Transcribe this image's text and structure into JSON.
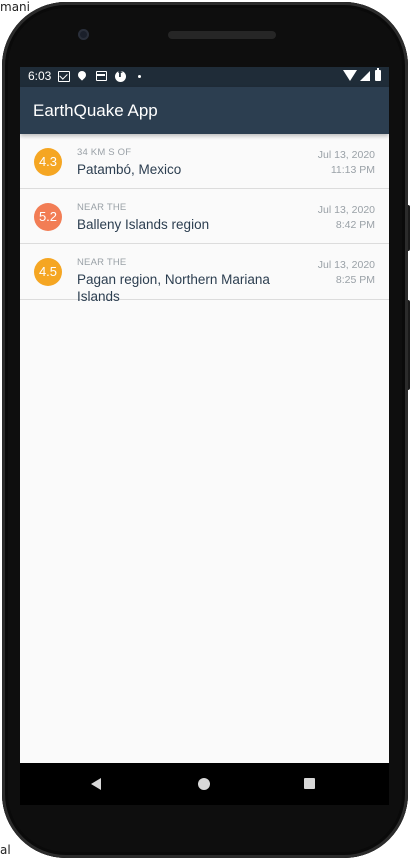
{
  "background": {
    "top_left_text": "mani",
    "left_text": "al"
  },
  "status_bar": {
    "time": "6:03",
    "icons": [
      "gmail-icon",
      "location-pin-icon",
      "card-icon",
      "facebook-icon",
      "notification-dot-icon",
      "wifi-icon",
      "signal-icon",
      "battery-icon"
    ]
  },
  "app_bar": {
    "title": "EarthQuake App",
    "color": "#2c3e50"
  },
  "earthquakes": [
    {
      "magnitude": "4.3",
      "color": "#f5a623",
      "offset": "34 km S of",
      "location": "Patambó, Mexico",
      "date": "Jul 13, 2020",
      "time": "11:13 PM"
    },
    {
      "magnitude": "5.2",
      "color": "#f27d55",
      "offset": "Near the",
      "location": "Balleny Islands region",
      "date": "Jul 13, 2020",
      "time": "8:42 PM"
    },
    {
      "magnitude": "4.5",
      "color": "#f5a623",
      "offset": "Near the",
      "location": "Pagan region, Northern Mariana Islands",
      "date": "Jul 13, 2020",
      "time": "8:25 PM"
    }
  ],
  "nav_bar": {
    "icons": [
      "back-icon",
      "home-icon",
      "recents-icon"
    ]
  }
}
